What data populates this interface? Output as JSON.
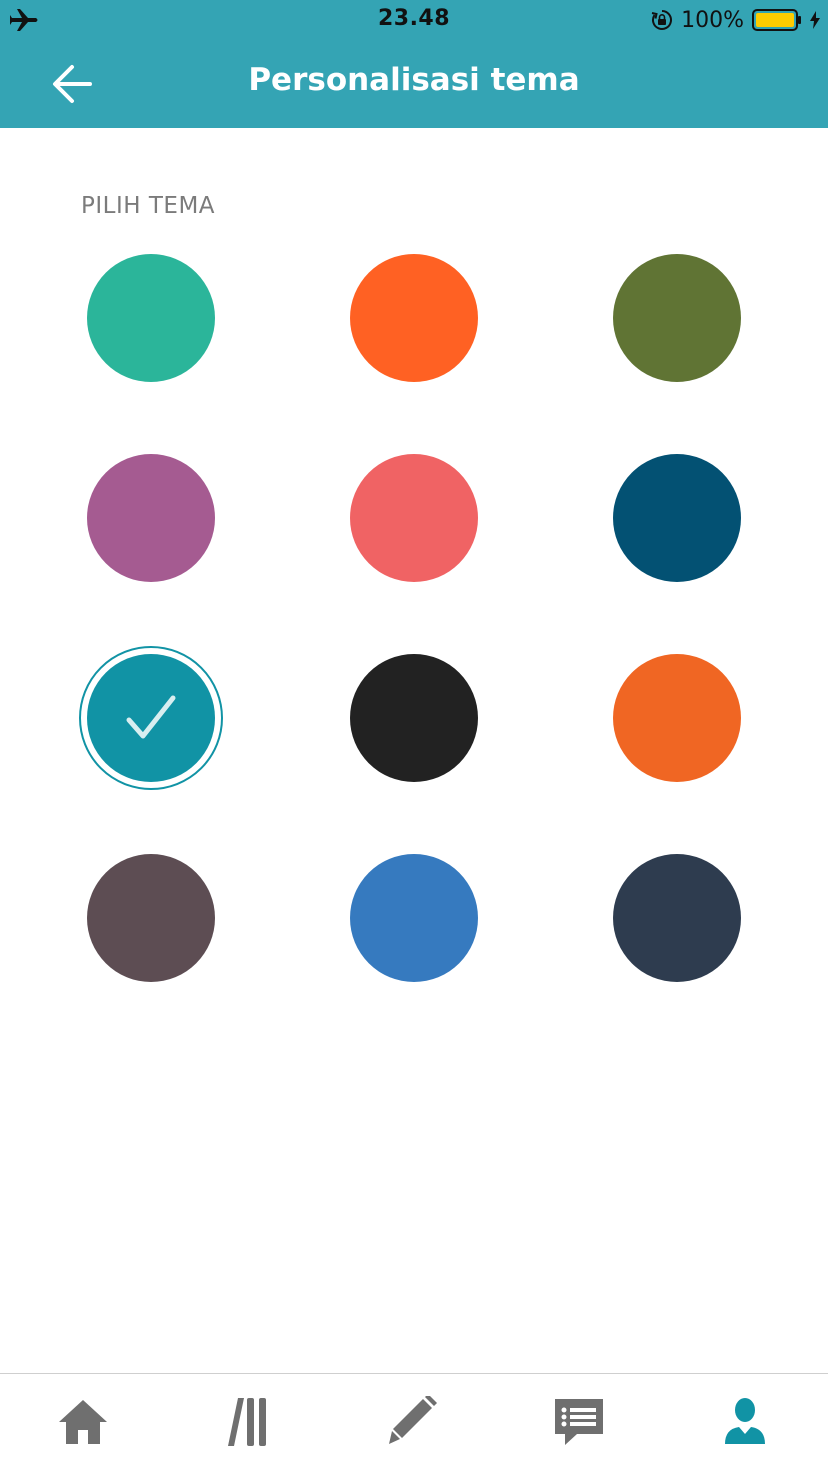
{
  "status_bar": {
    "time": "23.48",
    "battery": "100%",
    "icons": [
      "airplane-icon",
      "rotation-lock-icon",
      "battery-icon",
      "charging-bolt-icon"
    ],
    "battery_color": "#ffcc00"
  },
  "header": {
    "title": "Personalisasi tema",
    "back_icon": "arrow-left-icon",
    "background": "#34a4b4"
  },
  "themes": {
    "label": "PILIH TEMA",
    "selected_index": 6,
    "swatches": [
      {
        "color": "#2bb59a"
      },
      {
        "color": "#ff6123"
      },
      {
        "color": "#607434"
      },
      {
        "color": "#a55b91"
      },
      {
        "color": "#f06364"
      },
      {
        "color": "#035173"
      },
      {
        "color": "#1193a5"
      },
      {
        "color": "#222222"
      },
      {
        "color": "#f06623"
      },
      {
        "color": "#5d4d53"
      },
      {
        "color": "#367abf"
      },
      {
        "color": "#2e3c4f"
      }
    ]
  },
  "tab_bar": {
    "items": [
      {
        "icon": "home-icon",
        "active": false
      },
      {
        "icon": "library-icon",
        "active": false
      },
      {
        "icon": "pencil-icon",
        "active": false
      },
      {
        "icon": "message-list-icon",
        "active": false
      },
      {
        "icon": "profile-icon",
        "active": true
      }
    ],
    "inactive_color": "#6f6f6f",
    "active_color": "#1193a5"
  }
}
